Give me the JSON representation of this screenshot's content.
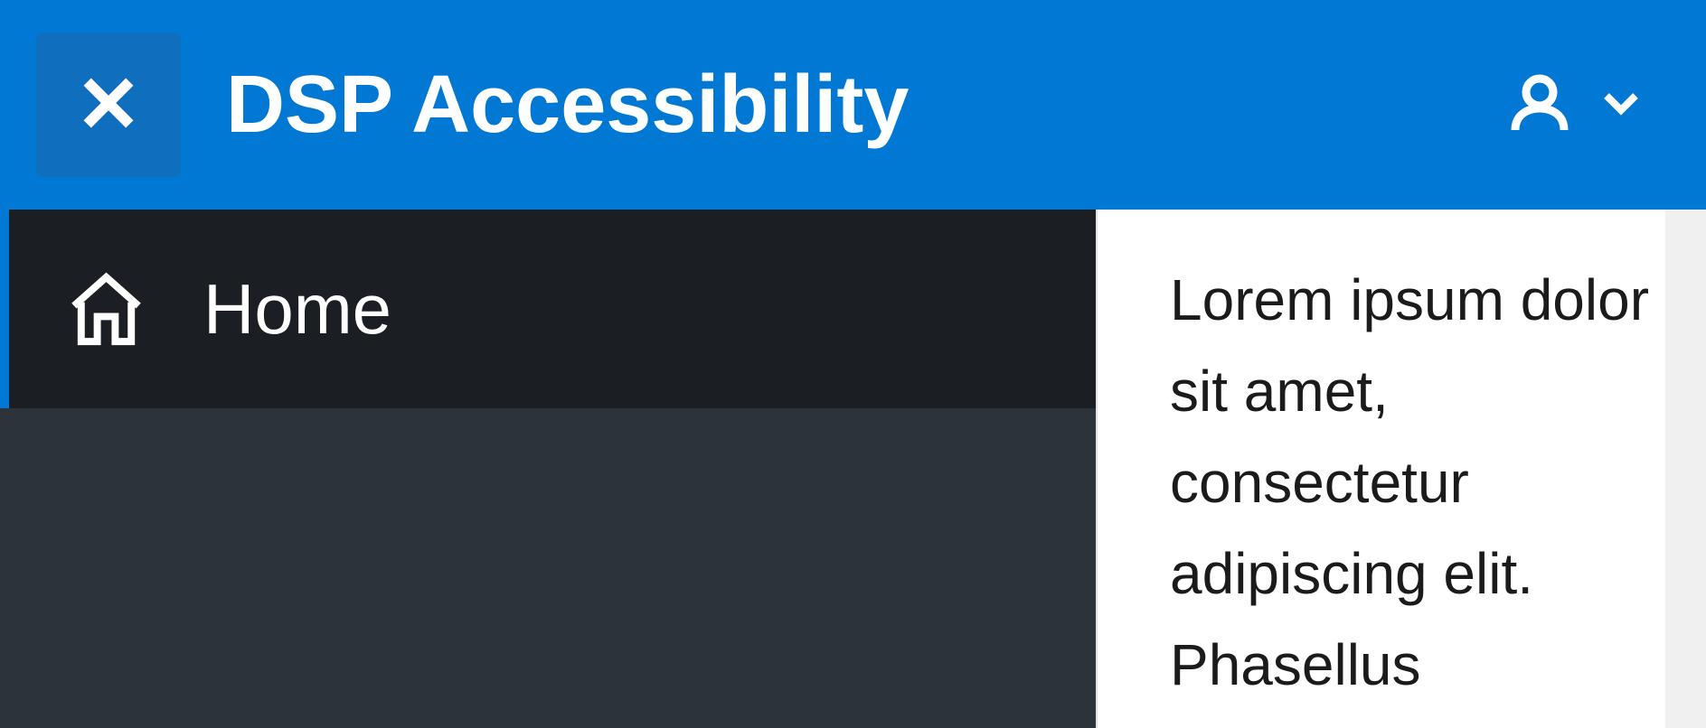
{
  "header": {
    "title": "DSP Accessibility"
  },
  "sidebar": {
    "items": [
      {
        "label": "Home",
        "icon": "home-icon"
      }
    ]
  },
  "main": {
    "body_text": "Lorem ipsum dolor sit amet, consectetur adipiscing elit. Phasellus"
  }
}
